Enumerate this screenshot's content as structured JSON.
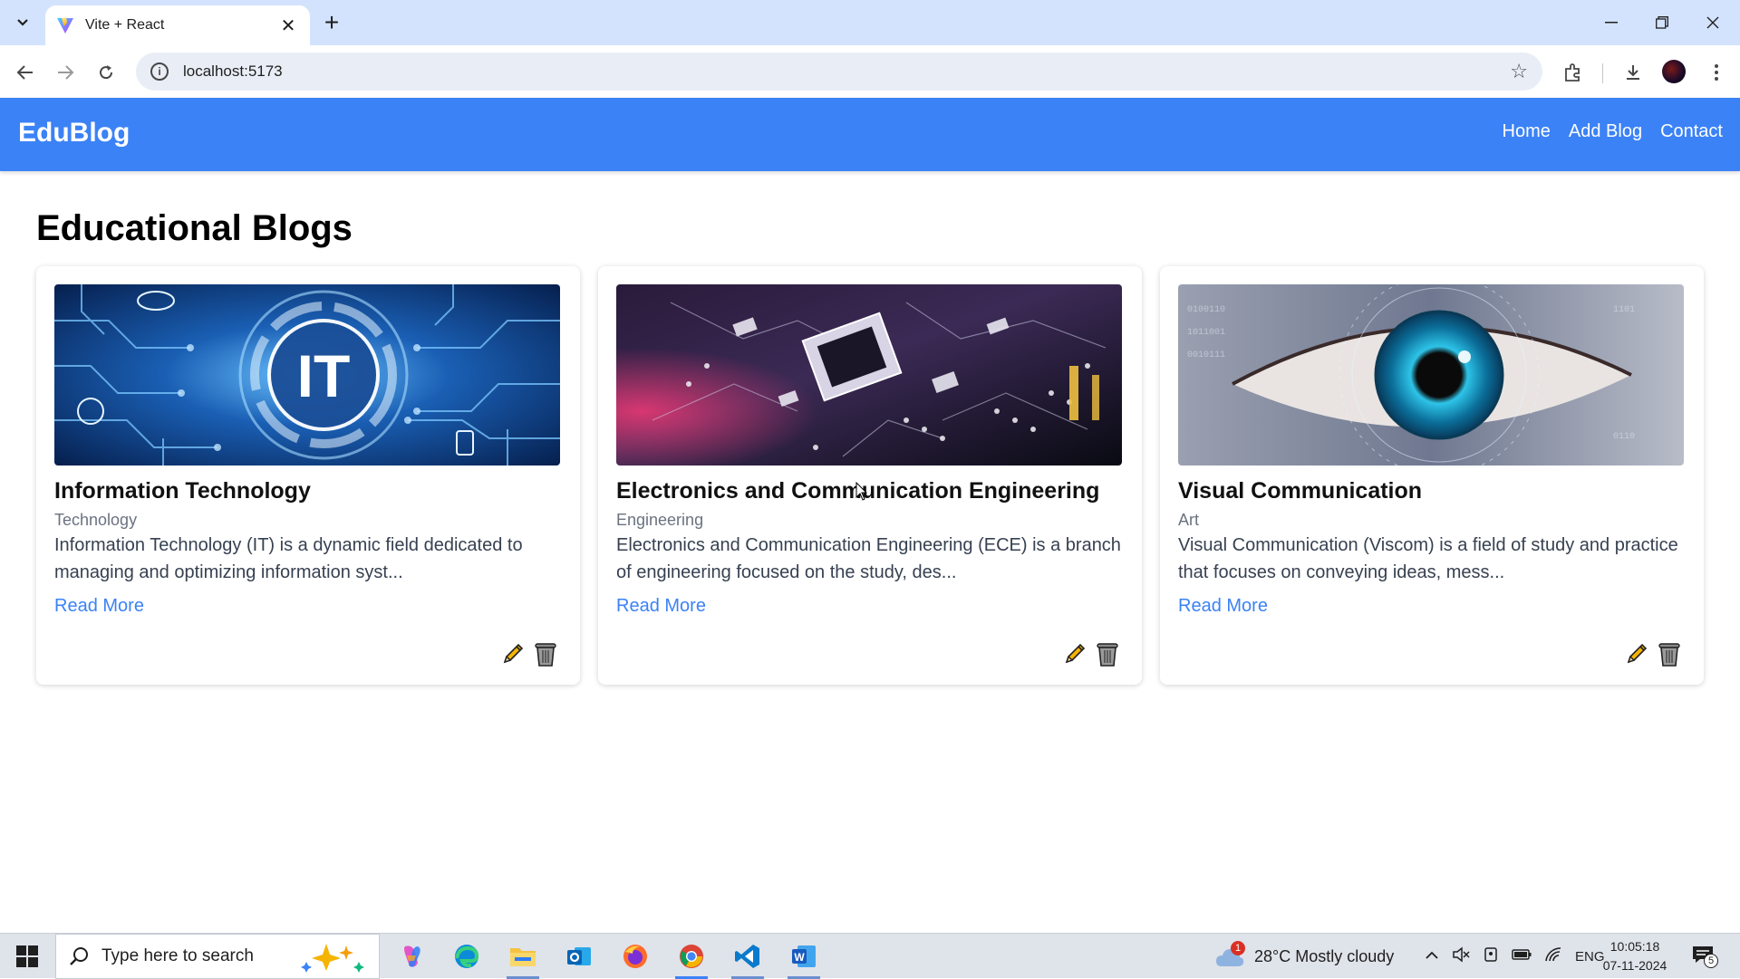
{
  "browser": {
    "tab_title": "Vite + React",
    "url": "localhost:5173"
  },
  "app": {
    "brand": "EduBlog",
    "nav": [
      "Home",
      "Add Blog",
      "Contact"
    ],
    "page_title": "Educational Blogs",
    "accent_color": "#3b82f6",
    "cards": [
      {
        "title": "Information Technology",
        "category": "Technology",
        "excerpt": "Information Technology (IT) is a dynamic field dedicated to managing and optimizing information syst...",
        "read_more": "Read More",
        "image_label": "IT"
      },
      {
        "title": "Electronics and Communication Engineering",
        "category": "Engineering",
        "excerpt": "Electronics and Communication Engineering (ECE) is a branch of engineering focused on the study, des...",
        "read_more": "Read More"
      },
      {
        "title": "Visual Communication",
        "category": "Art",
        "excerpt": "Visual Communication (Viscom) is a field of study and practice that focuses on conveying ideas, mess...",
        "read_more": "Read More"
      }
    ]
  },
  "taskbar": {
    "search_placeholder": "Type here to search",
    "weather": "28°C  Mostly cloudy",
    "weather_badge": "1",
    "language": "ENG",
    "time": "10:05:18",
    "date": "07-11-2024",
    "notification_count": "5"
  }
}
